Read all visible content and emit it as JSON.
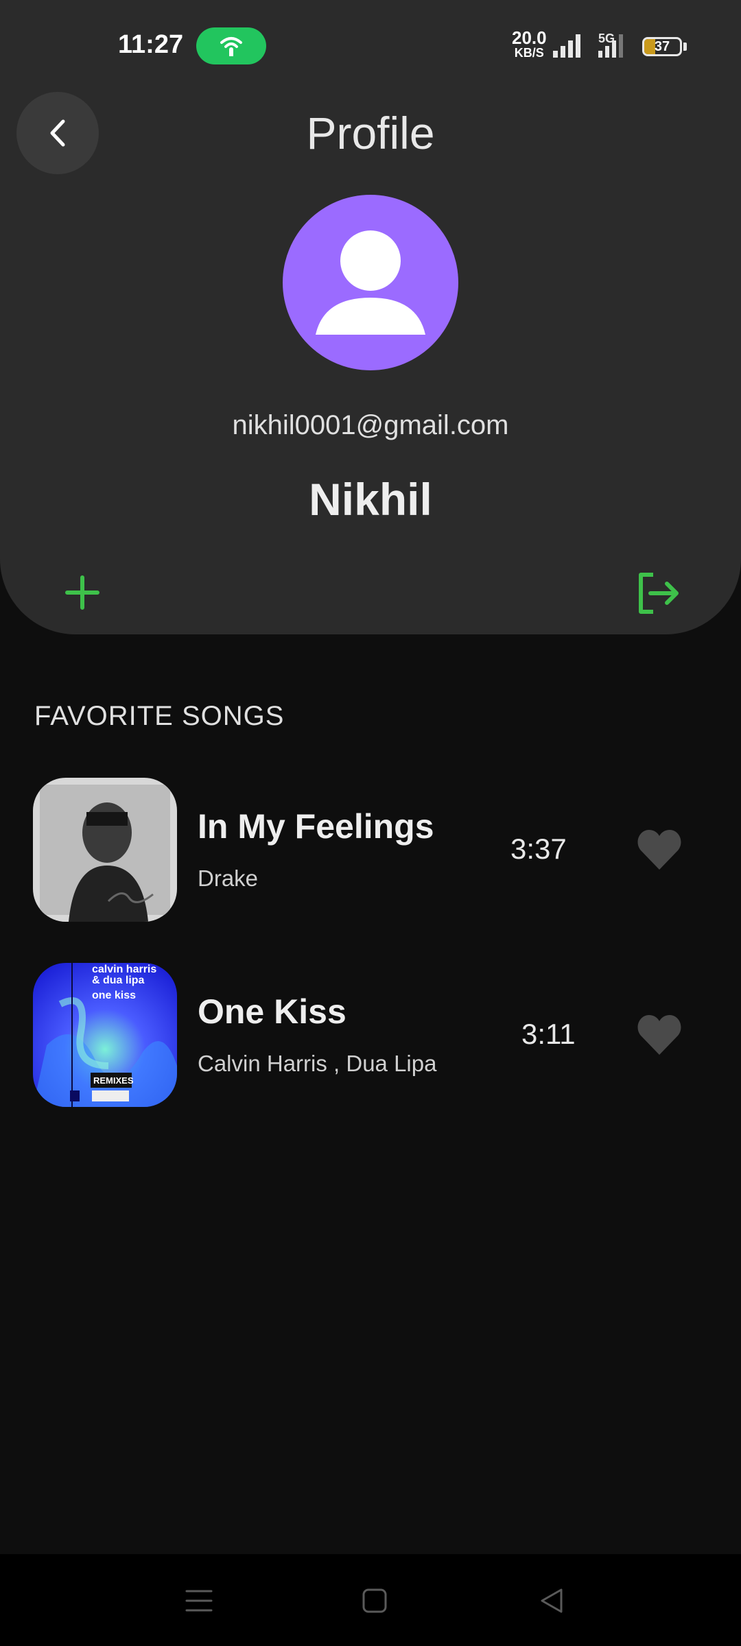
{
  "status_bar": {
    "time": "11:27",
    "net_speed_value": "20.0",
    "net_speed_unit": "KB/S",
    "network_type": "5G",
    "battery_level": "37"
  },
  "header": {
    "title": "Profile",
    "email": "nikhil0001@gmail.com",
    "username": "Nikhil"
  },
  "favorites": {
    "section_title": "FAVORITE SONGS",
    "songs": [
      {
        "title": "In My Feelings",
        "artist": "Drake",
        "duration": "3:37"
      },
      {
        "title": "One Kiss",
        "artist": "Calvin Harris , Dua Lipa",
        "duration": "3:11"
      }
    ],
    "album_art_text": {
      "line1": "calvin harris",
      "line2": "& dua lipa",
      "line3": "one kiss",
      "badge": "REMIXES"
    }
  },
  "colors": {
    "accent_green": "#3ec14a",
    "avatar_purple": "#9b6bff",
    "card_bg": "#2b2b2b",
    "page_bg": "#0e0e0e"
  },
  "icons": [
    "back-icon",
    "user-icon",
    "add-icon",
    "logout-icon",
    "heart-icon",
    "menu-icon",
    "home-icon",
    "back-triangle-icon"
  ]
}
